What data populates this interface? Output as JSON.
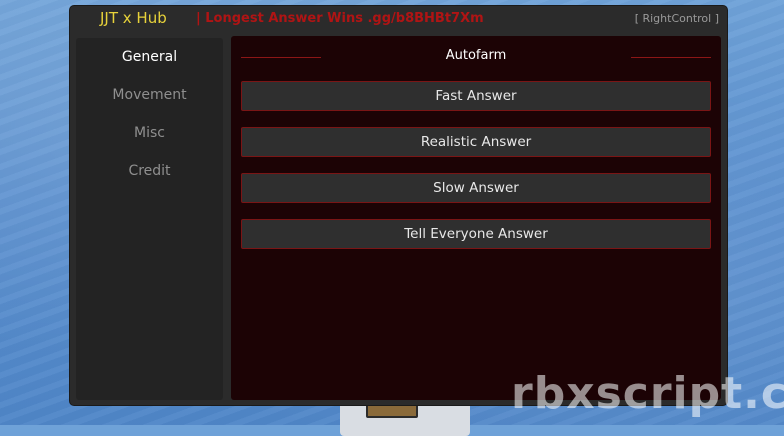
{
  "window": {
    "title": "JJT x Hub",
    "subtitle": "| Longest Answer Wins .gg/b8BHBt7Xm",
    "keybind": "[ RightControl ]"
  },
  "sidebar": {
    "items": [
      {
        "label": "General",
        "active": true
      },
      {
        "label": "Movement",
        "active": false
      },
      {
        "label": "Misc",
        "active": false
      },
      {
        "label": "Credit",
        "active": false
      }
    ]
  },
  "main": {
    "section_title": "Autofarm",
    "buttons": [
      {
        "label": "Fast Answer"
      },
      {
        "label": "Realistic Answer"
      },
      {
        "label": "Slow Answer"
      },
      {
        "label": "Tell Everyone Answer"
      }
    ]
  },
  "watermark": "rbxscript.co",
  "colors": {
    "title": "#e7d23a",
    "subtitle": "#b01414",
    "accent_border": "#7a1515",
    "content_bg": "#1c0305",
    "panel_bg": "#2b2b2b"
  }
}
